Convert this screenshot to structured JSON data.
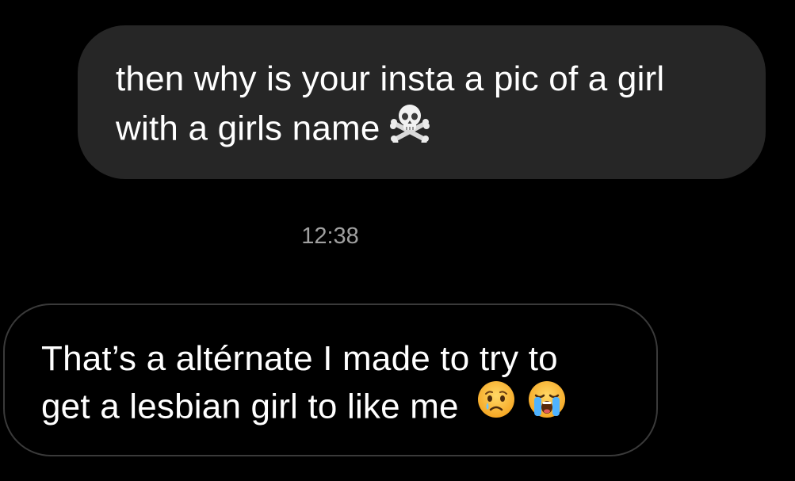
{
  "messages": [
    {
      "direction": "sent",
      "lines": [
        "then why is your insta a pic of a girl",
        "with a girls name"
      ],
      "emojis": [
        "skull-and-crossbones-icon"
      ]
    },
    {
      "direction": "received",
      "lines": [
        "That’s a altérnate I made to try to",
        "get a lesbian girl to like me"
      ],
      "emojis": [
        "crying-face-icon",
        "loudly-crying-face-icon"
      ]
    }
  ],
  "timestamp": "12:38",
  "colors": {
    "background": "#000000",
    "sent_bubble": "#262626",
    "received_bubble_border": "#3a3a3a",
    "text": "#ffffff",
    "timestamp": "#a0a0a0"
  }
}
